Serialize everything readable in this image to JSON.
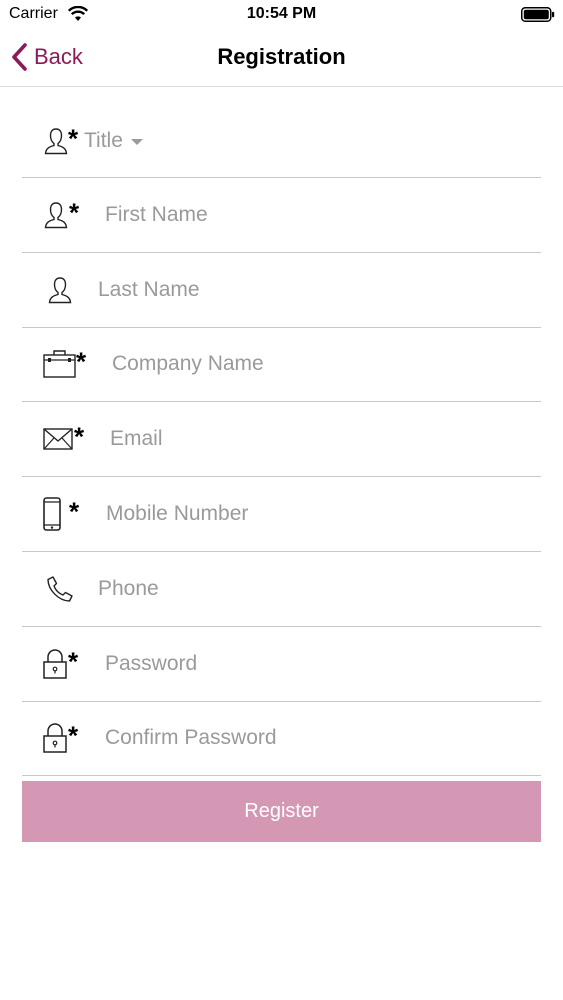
{
  "status_bar": {
    "carrier": "Carrier",
    "time": "10:54 PM",
    "wifi_icon": "wifi-icon",
    "battery_icon": "battery-icon"
  },
  "nav": {
    "back_label": "Back",
    "title": "Registration",
    "accent_color": "#8b1a58"
  },
  "form": {
    "title_select": {
      "value": "Title",
      "icon": "user-icon",
      "required": "*"
    },
    "fields": [
      {
        "placeholder": "First Name",
        "icon": "user-icon",
        "required": "*"
      },
      {
        "placeholder": "Last Name",
        "icon": "user-icon",
        "required": ""
      },
      {
        "placeholder": "Company Name",
        "icon": "briefcase-icon",
        "required": "*"
      },
      {
        "placeholder": "Email",
        "icon": "envelope-icon",
        "required": "*"
      },
      {
        "placeholder": "Mobile Number",
        "icon": "mobile-phone-icon",
        "required": "*"
      },
      {
        "placeholder": "Phone",
        "icon": "phone-icon",
        "required": ""
      },
      {
        "placeholder": "Password",
        "icon": "lock-icon",
        "required": "*"
      },
      {
        "placeholder": "Confirm Password",
        "icon": "lock-icon",
        "required": "*"
      }
    ]
  },
  "register": {
    "label": "Register",
    "color": "#d498b5"
  }
}
